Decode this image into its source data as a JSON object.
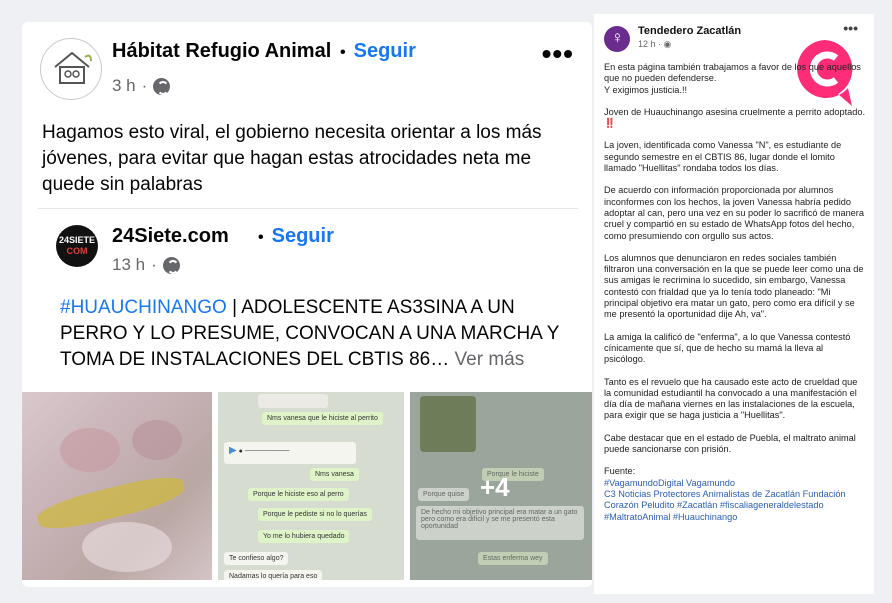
{
  "main_post": {
    "page_name": "Hábitat Refugio Animal",
    "follow_label": "Seguir",
    "time": "3 h",
    "text": "Hagamos esto viral, el gobierno necesita orientar a los más jóvenes, para evitar que hagan estas atrocidades  neta me quede sin palabras"
  },
  "shared_post": {
    "page_name": "24Siete.com",
    "follow_label": "Seguir",
    "time": "13 h",
    "hashtag": "#HUAUCHINANGO",
    "text": " | ADOLESCENTE AS3SINA A UN PERRO Y LO PRESUME, CONVOCAN A UNA MARCHA Y TOMA DE INSTALACIONES DEL CBTIS 86…",
    "see_more": "Ver más",
    "logo_text_top": "24SIETE",
    "logo_text_bottom": "COM"
  },
  "photos": {
    "more_count": "+4",
    "chat_lines": [
      "Nms vanesa que le hiciste al perrito",
      "Nms vanesa",
      "Porque le hiciste eso al perro",
      "Porque le pediste si no lo querías",
      "Yo me lo hubiera quedado",
      "Te confieso algo?",
      "Nadamas lo quería para eso",
      "Porque le hiciste",
      "Porque quise",
      "De hecho mi objetivo principal era matar a un gato pero como era difícil y se me presentó esta oportunidad",
      "Estas enferma wey"
    ]
  },
  "right_post": {
    "page_name": "Tendedero Zacatlán",
    "time": "12 h",
    "paragraphs": [
      "En esta página también trabajamos a favor de los que aquellos que no pueden defenderse.\nY exigimos justicia.!!",
      "Joven de Huauchinango asesina cruelmente a perrito adoptado. ‼️",
      "La joven, identificada como Vanessa \"N\", es estudiante de segundo semestre en el CBTIS 86, lugar donde el lomito llamado \"Huellitas\" rondaba todos los días.",
      "De acuerdo con información proporcionada por alumnos inconformes con los hechos, la joven Vanessa habría pedido adoptar al can, pero una vez en su poder lo sacrificó de manera cruel y compartió en su estado de WhatsApp fotos del hecho, como presumiendo con orgullo sus actos.",
      "Los alumnos que denunciaron en redes sociales también filtraron una conversación en la que se puede leer como una de sus amigas le recrimina lo sucedido, sin embargo, Vanessa contestó con frialdad que ya lo tenía todo planeado: \"Mi principal objetivo era matar un gato, pero como era difícil y se me presentó la oportunidad dije Ah, va\".",
      "La amiga la calificó de \"enferma\", a lo que Vanessa contestó cínicamente que sí, que de hecho su mamá la lleva al psicólogo.",
      "Tanto es el revuelo que ha causado este acto de crueldad que la comunidad estudiantil ha convocado a una manifestación el día día de mañana viernes en las instalaciones de la escuela, para exigir que se haga justicia a \"Huellitas\".",
      "Cabe destacar que en el estado de Puebla, el maltrato animal puede sancionarse con prisión."
    ],
    "source_label": "Fuente:",
    "source_tags": "#VagamundoDigital Vagamundo\nC3 Noticias Protectores Animalistas de Zacatlán Fundación Corazón Peludito #Zacatlán #fiscaliageneraldelestado #MaltratoAnimal #Huauchinango"
  },
  "colors": {
    "facebook_blue": "#1877f2",
    "watermark_pink": "#ff2d78"
  }
}
